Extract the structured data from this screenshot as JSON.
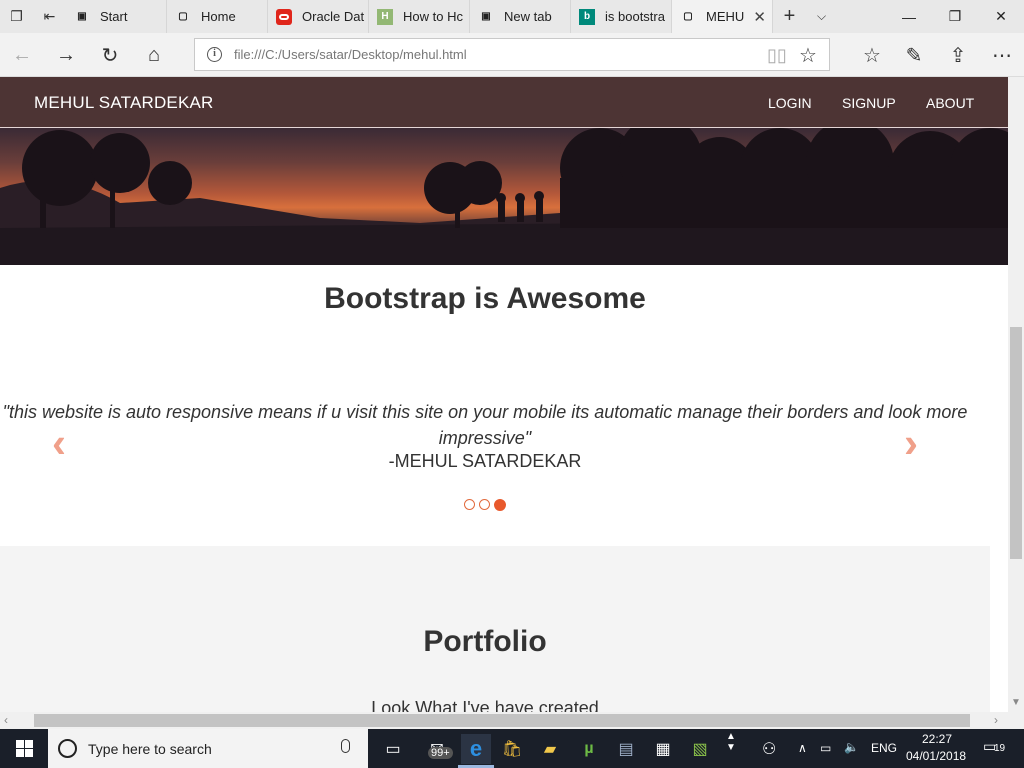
{
  "browser": {
    "tabs": [
      {
        "label": "Start",
        "icon": "page-icon"
      },
      {
        "label": "Home",
        "icon": "page-icon"
      },
      {
        "label": "Oracle Dat",
        "icon": "oracle-icon"
      },
      {
        "label": "How to Hc",
        "icon": "wikihow-icon"
      },
      {
        "label": "New tab",
        "icon": "page-icon"
      },
      {
        "label": "is bootstra",
        "icon": "bing-icon"
      },
      {
        "label": "MEHU",
        "icon": "page-icon",
        "active": true
      }
    ],
    "url": "file:///C:/Users/satar/Desktop/mehul.html"
  },
  "site": {
    "brand": "MEHUL SATARDEKAR",
    "nav": [
      "LOGIN",
      "SIGNUP",
      "ABOUT"
    ],
    "heading": "Bootstrap is Awesome",
    "carousel": {
      "quote": "\"this website is auto responsive means if u visit this site on your mobile its automatic manage their borders and look more impressive\"",
      "author": "-MEHUL SATARDEKAR",
      "slides": 3,
      "active_slide": 3
    },
    "portfolio": {
      "title": "Portfolio",
      "subtitle": "Look What I've have created"
    },
    "colors": {
      "navbar": "#4d3434",
      "accent": "#e8592c",
      "arrow": "#f0a08a"
    }
  },
  "taskbar": {
    "search_placeholder": "Type here to search",
    "mail_badge": "99+",
    "language": "ENG",
    "time": "22:27",
    "date": "04/01/2018",
    "notifications": "19"
  }
}
